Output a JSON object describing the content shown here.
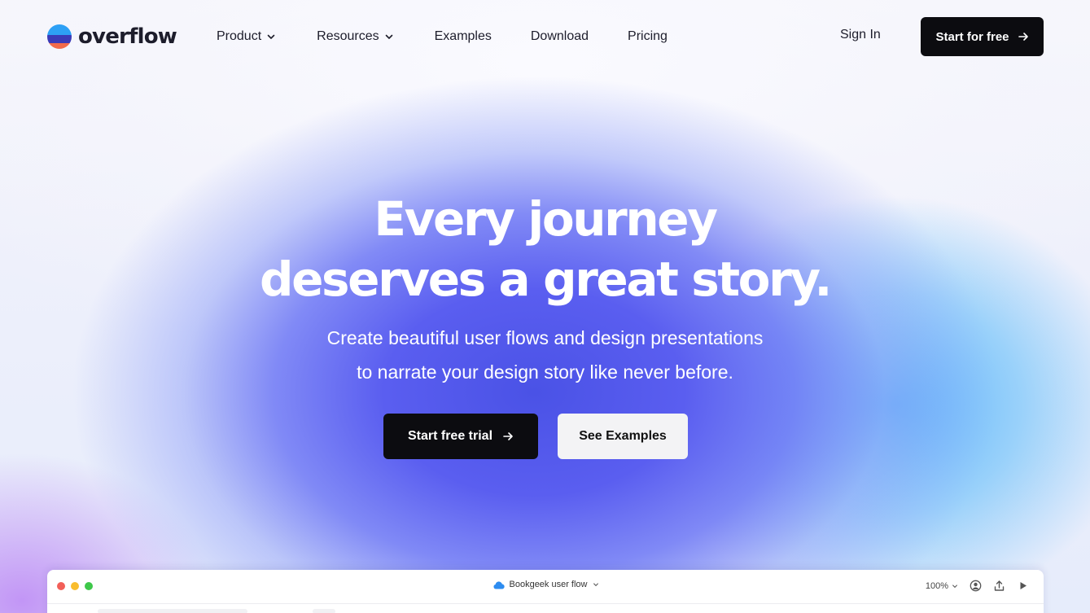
{
  "brand": {
    "name": "overflow",
    "colors": {
      "top": "#2da0f5",
      "middle": "#3a3ab8",
      "bottom": "#f26a4b"
    }
  },
  "nav": {
    "items": [
      {
        "label": "Product",
        "has_dropdown": true
      },
      {
        "label": "Resources",
        "has_dropdown": true
      },
      {
        "label": "Examples",
        "has_dropdown": false
      },
      {
        "label": "Download",
        "has_dropdown": false
      },
      {
        "label": "Pricing",
        "has_dropdown": false
      }
    ],
    "signin_label": "Sign In",
    "cta_label": "Start for free"
  },
  "hero": {
    "headline_line1": "Every journey",
    "headline_line2": "deserves a great story.",
    "subtitle_line1": "Create beautiful user flows and design presentations",
    "subtitle_line2": "to narrate your design story like never before.",
    "primary_cta": "Start free trial",
    "secondary_cta": "See Examples"
  },
  "app_preview": {
    "document_title": "Bookgeek user flow",
    "zoom": "100%",
    "icons": [
      "cloud-icon",
      "user-add-icon",
      "share-icon",
      "play-icon"
    ]
  },
  "colors": {
    "dark_button": "#0c0c10",
    "light_button": "#f3f3f5",
    "hero_gradient_center": "#4a52e6",
    "hero_gradient_right": "#50aff8"
  }
}
